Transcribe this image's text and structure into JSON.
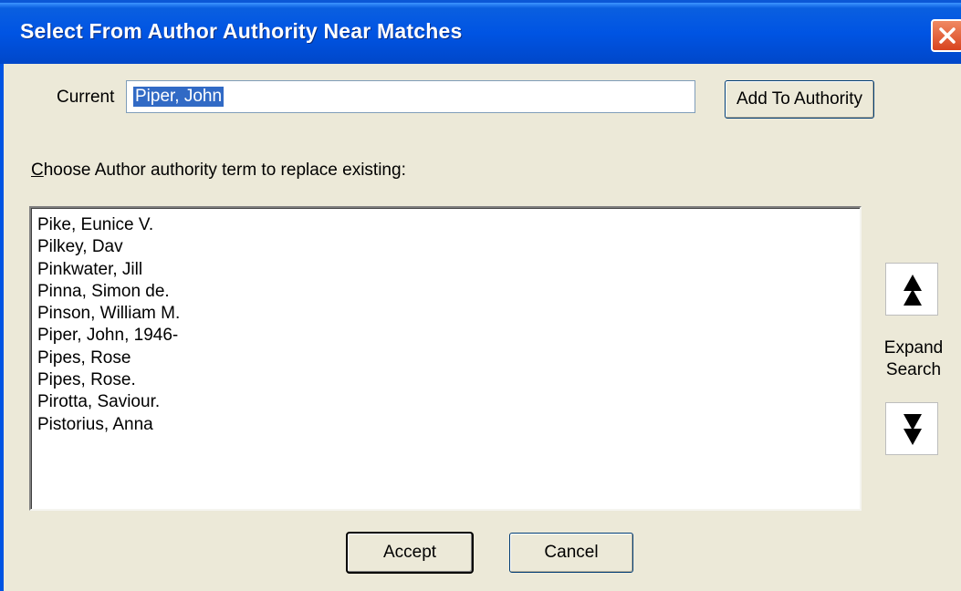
{
  "window": {
    "title": "Select From Author Authority Near Matches",
    "close_icon": "close-icon"
  },
  "current": {
    "label": "Current",
    "value": "Piper, John",
    "add_button": "Add To Authority"
  },
  "choose": {
    "accesskey": "C",
    "label_rest": "hoose Author authority term to replace existing:"
  },
  "results": [
    "Pike, Eunice V.",
    "Pilkey, Dav",
    "Pinkwater, Jill",
    "Pinna, Simon de.",
    "Pinson, William M.",
    "Piper, John, 1946-",
    "Pipes, Rose",
    "Pipes, Rose.",
    "Pirotta, Saviour.",
    "Pistorius, Anna"
  ],
  "expand": {
    "line1": "Expand",
    "line2": "Search",
    "up_icon": "expand-up-icon",
    "down_icon": "expand-down-icon"
  },
  "buttons": {
    "accept": "Accept",
    "cancel": "Cancel"
  },
  "colors": {
    "titlebar": "#0054e3",
    "dialog_bg": "#ece9d8",
    "selection": "#316ac5",
    "close": "#d8431f"
  }
}
